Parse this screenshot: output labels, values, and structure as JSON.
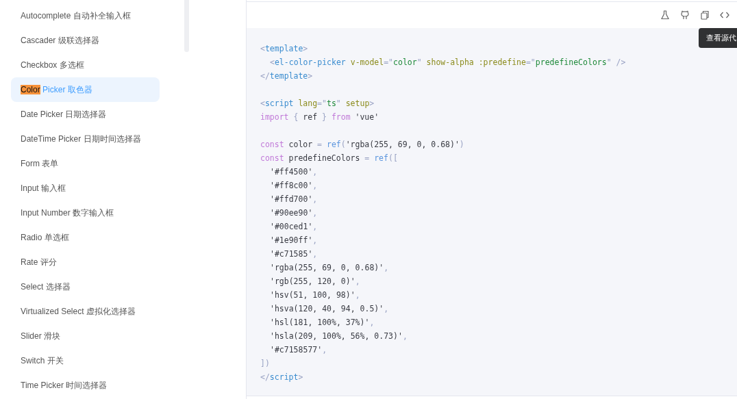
{
  "sidebar": {
    "items": [
      {
        "label": "Autocomplete 自动补全输入框",
        "selected": false
      },
      {
        "label": "Cascader 级联选择器",
        "selected": false
      },
      {
        "label": "Checkbox 多选框",
        "selected": false
      },
      {
        "highlight": "Color",
        "label": "Picker 取色器",
        "selected": true
      },
      {
        "label": "Date Picker 日期选择器",
        "selected": false
      },
      {
        "label": "DateTime Picker 日期时间选择器",
        "selected": false
      },
      {
        "label": "Form 表单",
        "selected": false
      },
      {
        "label": "Input 输入框",
        "selected": false
      },
      {
        "label": "Input Number 数字输入框",
        "selected": false
      },
      {
        "label": "Radio 单选框",
        "selected": false
      },
      {
        "label": "Rate 评分",
        "selected": false
      },
      {
        "label": "Select 选择器",
        "selected": false
      },
      {
        "label": "Virtualized Select 虚拟化选择器",
        "selected": false
      },
      {
        "label": "Slider 滑块",
        "selected": false
      },
      {
        "label": "Switch 开关",
        "selected": false
      },
      {
        "label": "Time Picker 时间选择器",
        "selected": false
      }
    ]
  },
  "toolbar": {
    "icons": [
      {
        "kind": "flask"
      },
      {
        "kind": "github"
      },
      {
        "kind": "copy"
      },
      {
        "kind": "code"
      }
    ],
    "tooltip": "查看源代"
  },
  "code": {
    "blocks": [
      [
        {
          "indent": false,
          "tokens": [
            {
              "kind": "punct",
              "t": "<"
            },
            {
              "kind": "tag",
              "t": "template"
            },
            {
              "kind": "punct",
              "t": ">"
            }
          ]
        },
        {
          "indent": true,
          "tokens": [
            {
              "kind": "punct",
              "t": "<"
            },
            {
              "kind": "tag",
              "t": "el-color-picker"
            },
            {
              "kind": "attr",
              "t": " v-model"
            },
            {
              "kind": "punct",
              "t": "=\""
            },
            {
              "kind": "str",
              "t": "color"
            },
            {
              "kind": "punct",
              "t": "\""
            },
            {
              "kind": "attr",
              "t": " show-alpha :predefine"
            },
            {
              "kind": "punct",
              "t": "=\""
            },
            {
              "kind": "str",
              "t": "predefineColors"
            },
            {
              "kind": "punct",
              "t": "\" />"
            }
          ]
        },
        {
          "indent": false,
          "tokens": [
            {
              "kind": "punct",
              "t": "</"
            },
            {
              "kind": "tag",
              "t": "template"
            },
            {
              "kind": "punct",
              "t": ">"
            }
          ]
        }
      ],
      [
        {
          "indent": false,
          "tokens": [
            {
              "kind": "punct",
              "t": "<"
            },
            {
              "kind": "tag",
              "t": "script"
            },
            {
              "kind": "attr",
              "t": " lang"
            },
            {
              "kind": "punct",
              "t": "=\""
            },
            {
              "kind": "str",
              "t": "ts"
            },
            {
              "kind": "punct",
              "t": "\""
            },
            {
              "kind": "attr",
              "t": " setup"
            },
            {
              "kind": "punct",
              "t": ">"
            }
          ]
        },
        {
          "indent": false,
          "tokens": [
            {
              "kind": "kw",
              "t": "import"
            },
            {
              "kind": "punct",
              "t": " { "
            },
            {
              "kind": "plain",
              "t": "ref"
            },
            {
              "kind": "punct",
              "t": " } "
            },
            {
              "kind": "kw",
              "t": "from"
            },
            {
              "kind": "plain",
              "t": " 'vue'"
            }
          ]
        }
      ],
      [
        {
          "indent": false,
          "tokens": [
            {
              "kind": "kw",
              "t": "const"
            },
            {
              "kind": "plain",
              "t": " color "
            },
            {
              "kind": "punct",
              "t": "= "
            },
            {
              "kind": "fn",
              "t": "ref"
            },
            {
              "kind": "punct",
              "t": "("
            },
            {
              "kind": "plain",
              "t": "'rgba(255, 69, 0, 0.68)'"
            },
            {
              "kind": "punct",
              "t": ")"
            }
          ]
        },
        {
          "indent": false,
          "tokens": [
            {
              "kind": "kw",
              "t": "const"
            },
            {
              "kind": "plain",
              "t": " predefineColors "
            },
            {
              "kind": "punct",
              "t": "= "
            },
            {
              "kind": "fn",
              "t": "ref"
            },
            {
              "kind": "punct",
              "t": "(["
            }
          ]
        },
        {
          "indent": true,
          "tokens": [
            {
              "kind": "plain",
              "t": "'#ff4500'"
            },
            {
              "kind": "punct",
              "t": ","
            }
          ]
        },
        {
          "indent": true,
          "tokens": [
            {
              "kind": "plain",
              "t": "'#ff8c00'"
            },
            {
              "kind": "punct",
              "t": ","
            }
          ]
        },
        {
          "indent": true,
          "tokens": [
            {
              "kind": "plain",
              "t": "'#ffd700'"
            },
            {
              "kind": "punct",
              "t": ","
            }
          ]
        },
        {
          "indent": true,
          "tokens": [
            {
              "kind": "plain",
              "t": "'#90ee90'"
            },
            {
              "kind": "punct",
              "t": ","
            }
          ]
        },
        {
          "indent": true,
          "tokens": [
            {
              "kind": "plain",
              "t": "'#00ced1'"
            },
            {
              "kind": "punct",
              "t": ","
            }
          ]
        },
        {
          "indent": true,
          "tokens": [
            {
              "kind": "plain",
              "t": "'#1e90ff'"
            },
            {
              "kind": "punct",
              "t": ","
            }
          ]
        },
        {
          "indent": true,
          "tokens": [
            {
              "kind": "plain",
              "t": "'#c71585'"
            },
            {
              "kind": "punct",
              "t": ","
            }
          ]
        },
        {
          "indent": true,
          "tokens": [
            {
              "kind": "plain",
              "t": "'rgba(255, 69, 0, 0.68)'"
            },
            {
              "kind": "punct",
              "t": ","
            }
          ]
        },
        {
          "indent": true,
          "tokens": [
            {
              "kind": "plain",
              "t": "'rgb(255, 120, 0)'"
            },
            {
              "kind": "punct",
              "t": ","
            }
          ]
        },
        {
          "indent": true,
          "tokens": [
            {
              "kind": "plain",
              "t": "'hsv(51, 100, 98)'"
            },
            {
              "kind": "punct",
              "t": ","
            }
          ]
        },
        {
          "indent": true,
          "tokens": [
            {
              "kind": "plain",
              "t": "'hsva(120, 40, 94, 0.5)'"
            },
            {
              "kind": "punct",
              "t": ","
            }
          ]
        },
        {
          "indent": true,
          "tokens": [
            {
              "kind": "plain",
              "t": "'hsl(181, 100%, 37%)'"
            },
            {
              "kind": "punct",
              "t": ","
            }
          ]
        },
        {
          "indent": true,
          "tokens": [
            {
              "kind": "plain",
              "t": "'hsla(209, 100%, 56%, 0.73)'"
            },
            {
              "kind": "punct",
              "t": ","
            }
          ]
        },
        {
          "indent": true,
          "tokens": [
            {
              "kind": "plain",
              "t": "'#c7158577'"
            },
            {
              "kind": "punct",
              "t": ","
            }
          ]
        },
        {
          "indent": false,
          "tokens": [
            {
              "kind": "punct",
              "t": "])"
            }
          ]
        },
        {
          "indent": false,
          "tokens": [
            {
              "kind": "punct",
              "t": "</"
            },
            {
              "kind": "tag",
              "t": "script"
            },
            {
              "kind": "punct",
              "t": ">"
            }
          ]
        }
      ]
    ]
  }
}
